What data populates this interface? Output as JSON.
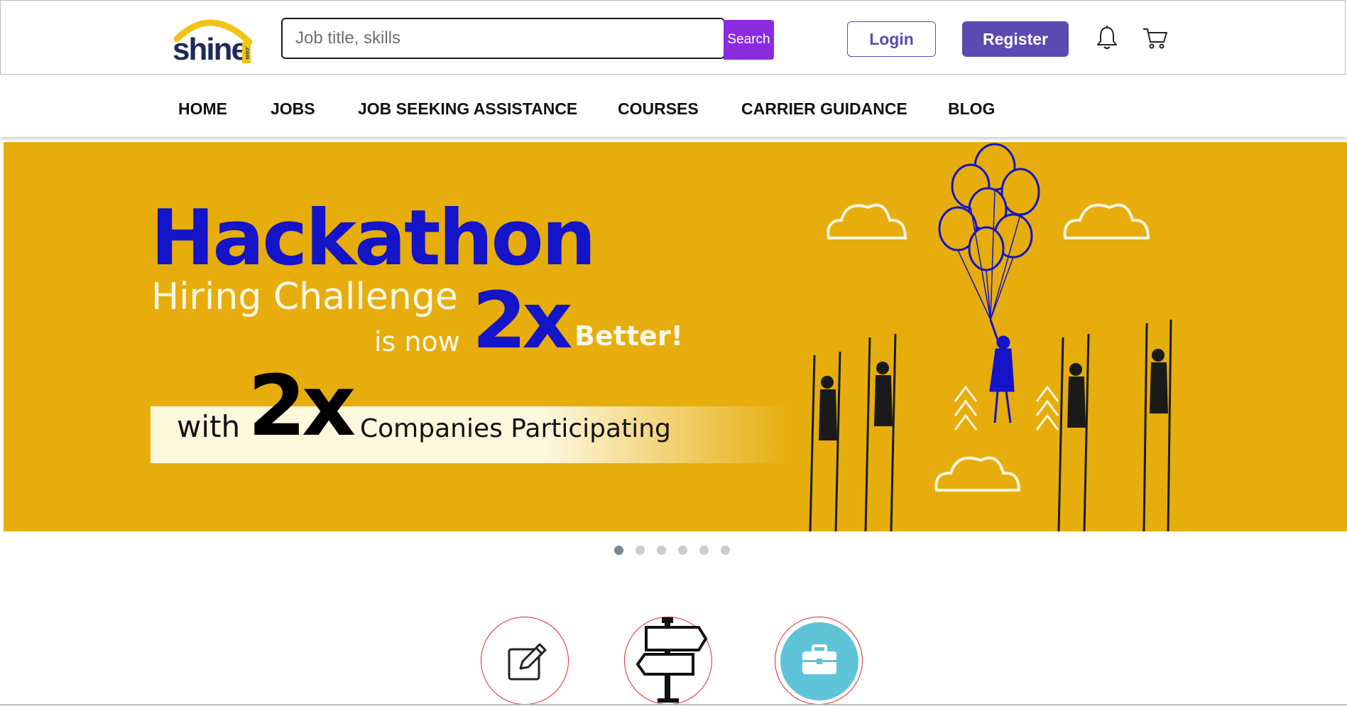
{
  "header": {
    "logo": {
      "brand": "shine",
      "badge": ".com"
    },
    "search": {
      "placeholder": "Job title, skills",
      "value": "",
      "button_label": "Search"
    },
    "login_label": "Login",
    "register_label": "Register",
    "icons": [
      "bell-icon",
      "cart-icon"
    ]
  },
  "nav": {
    "items": [
      {
        "label": "HOME"
      },
      {
        "label": "JOBS"
      },
      {
        "label": "JOB SEEKING ASSISTANCE"
      },
      {
        "label": "COURSES"
      },
      {
        "label": "CARRIER GUIDANCE"
      },
      {
        "label": "BLOG"
      }
    ]
  },
  "banner": {
    "headline": "Hackathon",
    "line2": "Hiring Challenge",
    "is_now": "is now",
    "multiplier": "2x",
    "better": "Better!",
    "with": "with",
    "multiplier2": "2x",
    "companies": "Companies Participating",
    "background_color": "#e6ad0c",
    "headline_color": "#1414c8"
  },
  "carousel": {
    "total_slides": 6,
    "active_index": 0
  },
  "feature_icons": [
    "edit-icon",
    "signpost-icon",
    "briefcase-icon"
  ],
  "colors": {
    "accent": "#5b4ab1",
    "search_button": "#8a2be2",
    "circle_border": "#e2232d",
    "briefcase_bg": "#5fc4d8"
  }
}
